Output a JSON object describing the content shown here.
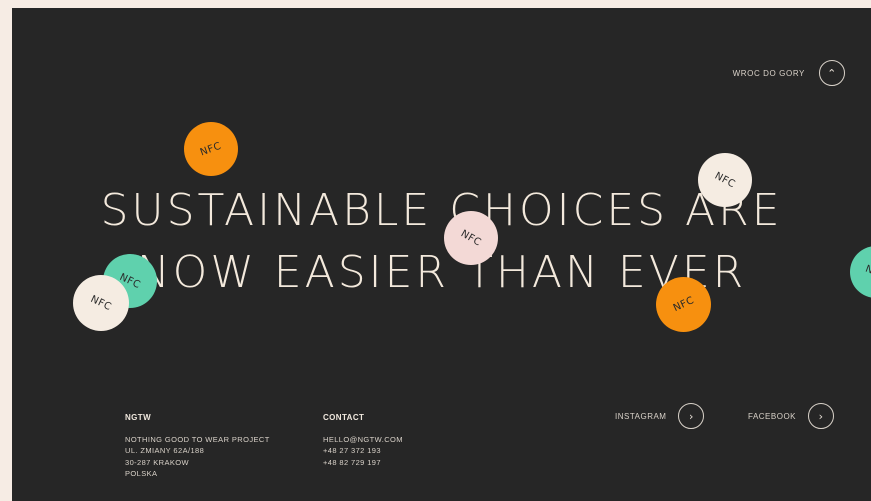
{
  "back_to_top": {
    "label": "WROC DO GORY",
    "icon": "chevron-up-icon"
  },
  "headline": {
    "line1": "SUSTAINABLE CHOICES ARE",
    "line2": "NOW EASIER THAN EVER"
  },
  "stickers": {
    "label": "NFC",
    "colors": {
      "orange": "#f7900f",
      "cream": "#f5ece2",
      "mint": "#5fd1ad",
      "pink": "#f3d9d6"
    }
  },
  "footer": {
    "brand": {
      "heading": "NGTW",
      "lines": [
        "NOTHING GOOD TO WEAR PROJECT",
        "UL. ZMIANY 62A/188",
        "30-287 KRAKOW",
        "POLSKA"
      ]
    },
    "contact": {
      "heading": "CONTACT",
      "lines": [
        "HELLO@NGTW.COM",
        "+48 27 372 193",
        "+48 82 729 197"
      ]
    },
    "social": [
      {
        "label": "INSTAGRAM",
        "icon": "chevron-right-icon"
      },
      {
        "label": "FACEBOOK",
        "icon": "chevron-right-icon"
      }
    ]
  },
  "colors": {
    "background": "#262626",
    "page": "#f6ece4",
    "text": "#f3e9dc"
  }
}
